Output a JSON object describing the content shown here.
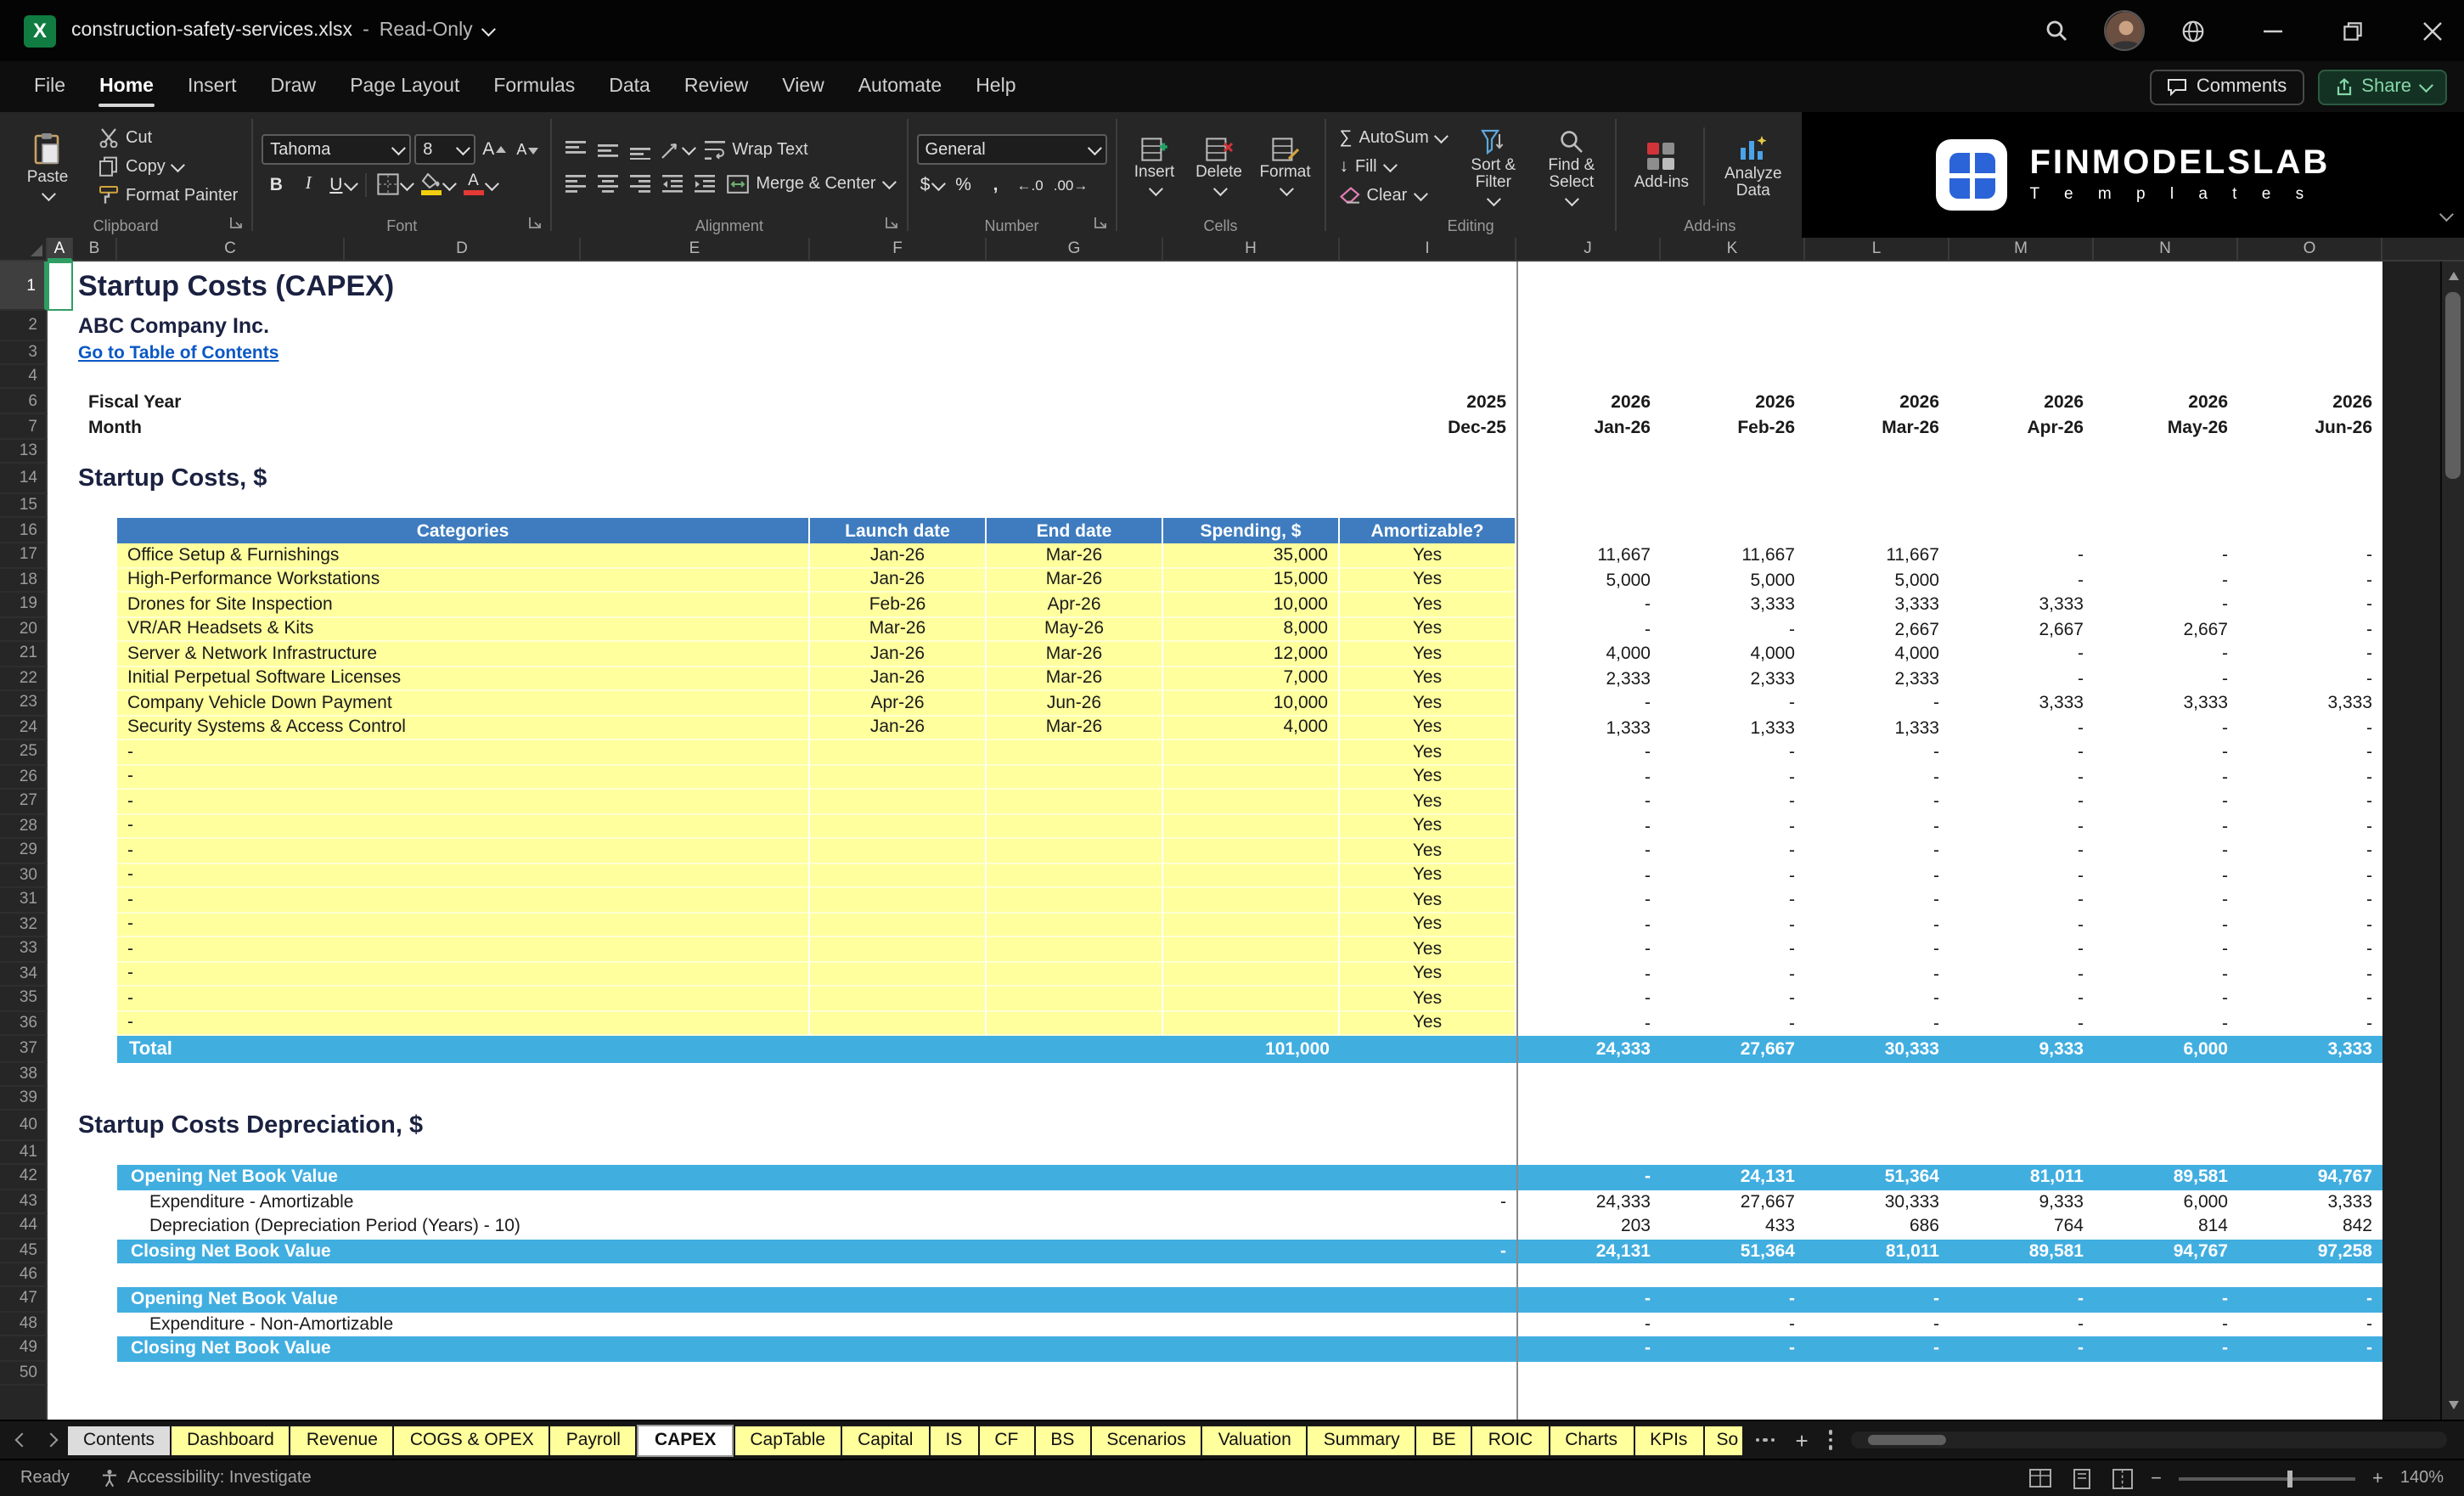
{
  "window": {
    "filename": "construction-safety-services.xlsx",
    "separator": "-",
    "mode": "Read-Only"
  },
  "menu": {
    "items": [
      "File",
      "Home",
      "Insert",
      "Draw",
      "Page Layout",
      "Formulas",
      "Data",
      "Review",
      "View",
      "Automate",
      "Help"
    ],
    "active_index": 1,
    "comments": "Comments",
    "share": "Share"
  },
  "ribbon": {
    "clipboard": {
      "group": "Clipboard",
      "paste": "Paste",
      "cut": "Cut",
      "copy": "Copy",
      "format_painter": "Format Painter"
    },
    "font": {
      "group": "Font",
      "family": "Tahoma",
      "size": "8"
    },
    "alignment": {
      "group": "Alignment",
      "wrap_text": "Wrap Text",
      "merge_center": "Merge & Center"
    },
    "number": {
      "group": "Number",
      "format": "General",
      "currency": "$",
      "percent": "%",
      "comma": ",",
      "increase_decimal": "←.0",
      "decrease_decimal": ".00→"
    },
    "cells": {
      "group": "Cells",
      "insert": "Insert",
      "delete": "Delete",
      "format": "Format"
    },
    "editing": {
      "group": "Editing",
      "autosum": "AutoSum",
      "fill": "Fill",
      "clear": "Clear",
      "sort_filter": "Sort & Filter",
      "find_select": "Find & Select"
    },
    "addins": {
      "group": "Add-ins",
      "addins": "Add-ins",
      "analyze": "Analyze Data"
    },
    "brand": {
      "name": "FINMODELSLAB",
      "tagline": "T e m p l a t e s"
    }
  },
  "colors": {
    "excel_green": "#107C41",
    "table_header_blue": "#3E7CBF",
    "band_cyan": "#41AEE0",
    "input_yellow": "#FFFF9E",
    "hyperlink_blue": "#0A58C4",
    "heading_navy": "#1B2140"
  },
  "sheet": {
    "columns": [
      "A",
      "B",
      "C",
      "D",
      "E",
      "F",
      "G",
      "H",
      "I",
      "J",
      "K",
      "L",
      "M",
      "N",
      "O"
    ],
    "rows": [
      {
        "n": "1",
        "type": "title",
        "text": "Startup Costs (CAPEX)"
      },
      {
        "n": "2",
        "type": "company",
        "text": "ABC Company Inc."
      },
      {
        "n": "3",
        "type": "link",
        "text": "Go to Table of Contents"
      },
      {
        "n": "4",
        "type": "blank"
      },
      {
        "n": "6",
        "type": "period",
        "label": "Fiscal Year",
        "dec": "2025",
        "months": [
          "2026",
          "2026",
          "2026",
          "2026",
          "2026",
          "2026"
        ]
      },
      {
        "n": "7",
        "type": "period",
        "label": "Month",
        "dec": "Dec-25",
        "months": [
          "Jan-26",
          "Feb-26",
          "Mar-26",
          "Apr-26",
          "May-26",
          "Jun-26"
        ]
      },
      {
        "n": "13",
        "type": "blank"
      },
      {
        "n": "14",
        "type": "heading",
        "text": "Startup Costs, $"
      },
      {
        "n": "15",
        "type": "blank"
      },
      {
        "n": "16",
        "type": "thead",
        "headers": [
          "Categories",
          "Launch date",
          "End date",
          "Spending, $",
          "Amortizable?"
        ]
      },
      {
        "n": "17",
        "type": "cost",
        "category": "Office Setup & Furnishings",
        "launch": "Jan-26",
        "end": "Mar-26",
        "spending": "35,000",
        "amort": "Yes",
        "monthly": [
          "11,667",
          "11,667",
          "11,667",
          "-",
          "-",
          "-"
        ]
      },
      {
        "n": "18",
        "type": "cost",
        "category": "High-Performance Workstations",
        "launch": "Jan-26",
        "end": "Mar-26",
        "spending": "15,000",
        "amort": "Yes",
        "monthly": [
          "5,000",
          "5,000",
          "5,000",
          "-",
          "-",
          "-"
        ]
      },
      {
        "n": "19",
        "type": "cost",
        "category": "Drones for Site Inspection",
        "launch": "Feb-26",
        "end": "Apr-26",
        "spending": "10,000",
        "amort": "Yes",
        "monthly": [
          "-",
          "3,333",
          "3,333",
          "3,333",
          "-",
          "-"
        ]
      },
      {
        "n": "20",
        "type": "cost",
        "category": "VR/AR Headsets & Kits",
        "launch": "Mar-26",
        "end": "May-26",
        "spending": "8,000",
        "amort": "Yes",
        "monthly": [
          "-",
          "-",
          "2,667",
          "2,667",
          "2,667",
          "-"
        ]
      },
      {
        "n": "21",
        "type": "cost",
        "category": "Server & Network Infrastructure",
        "launch": "Jan-26",
        "end": "Mar-26",
        "spending": "12,000",
        "amort": "Yes",
        "monthly": [
          "4,000",
          "4,000",
          "4,000",
          "-",
          "-",
          "-"
        ]
      },
      {
        "n": "22",
        "type": "cost",
        "category": "Initial Perpetual Software Licenses",
        "launch": "Jan-26",
        "end": "Mar-26",
        "spending": "7,000",
        "amort": "Yes",
        "monthly": [
          "2,333",
          "2,333",
          "2,333",
          "-",
          "-",
          "-"
        ]
      },
      {
        "n": "23",
        "type": "cost",
        "category": "Company Vehicle Down Payment",
        "launch": "Apr-26",
        "end": "Jun-26",
        "spending": "10,000",
        "amort": "Yes",
        "monthly": [
          "-",
          "-",
          "-",
          "3,333",
          "3,333",
          "3,333"
        ]
      },
      {
        "n": "24",
        "type": "cost",
        "category": "Security Systems & Access Control",
        "launch": "Jan-26",
        "end": "Mar-26",
        "spending": "4,000",
        "amort": "Yes",
        "monthly": [
          "1,333",
          "1,333",
          "1,333",
          "-",
          "-",
          "-"
        ]
      },
      {
        "n": "25",
        "type": "cost",
        "category": "-",
        "launch": "",
        "end": "",
        "spending": "",
        "amort": "Yes",
        "monthly": [
          "-",
          "-",
          "-",
          "-",
          "-",
          "-"
        ]
      },
      {
        "n": "26",
        "type": "cost",
        "category": "-",
        "launch": "",
        "end": "",
        "spending": "",
        "amort": "Yes",
        "monthly": [
          "-",
          "-",
          "-",
          "-",
          "-",
          "-"
        ]
      },
      {
        "n": "27",
        "type": "cost",
        "category": "-",
        "launch": "",
        "end": "",
        "spending": "",
        "amort": "Yes",
        "monthly": [
          "-",
          "-",
          "-",
          "-",
          "-",
          "-"
        ]
      },
      {
        "n": "28",
        "type": "cost",
        "category": "-",
        "launch": "",
        "end": "",
        "spending": "",
        "amort": "Yes",
        "monthly": [
          "-",
          "-",
          "-",
          "-",
          "-",
          "-"
        ]
      },
      {
        "n": "29",
        "type": "cost",
        "category": "-",
        "launch": "",
        "end": "",
        "spending": "",
        "amort": "Yes",
        "monthly": [
          "-",
          "-",
          "-",
          "-",
          "-",
          "-"
        ]
      },
      {
        "n": "30",
        "type": "cost",
        "category": "-",
        "launch": "",
        "end": "",
        "spending": "",
        "amort": "Yes",
        "monthly": [
          "-",
          "-",
          "-",
          "-",
          "-",
          "-"
        ]
      },
      {
        "n": "31",
        "type": "cost",
        "category": "-",
        "launch": "",
        "end": "",
        "spending": "",
        "amort": "Yes",
        "monthly": [
          "-",
          "-",
          "-",
          "-",
          "-",
          "-"
        ]
      },
      {
        "n": "32",
        "type": "cost",
        "category": "-",
        "launch": "",
        "end": "",
        "spending": "",
        "amort": "Yes",
        "monthly": [
          "-",
          "-",
          "-",
          "-",
          "-",
          "-"
        ]
      },
      {
        "n": "33",
        "type": "cost",
        "category": "-",
        "launch": "",
        "end": "",
        "spending": "",
        "amort": "Yes",
        "monthly": [
          "-",
          "-",
          "-",
          "-",
          "-",
          "-"
        ]
      },
      {
        "n": "34",
        "type": "cost",
        "category": "-",
        "launch": "",
        "end": "",
        "spending": "",
        "amort": "Yes",
        "monthly": [
          "-",
          "-",
          "-",
          "-",
          "-",
          "-"
        ]
      },
      {
        "n": "35",
        "type": "cost",
        "category": "-",
        "launch": "",
        "end": "",
        "spending": "",
        "amort": "Yes",
        "monthly": [
          "-",
          "-",
          "-",
          "-",
          "-",
          "-"
        ]
      },
      {
        "n": "36",
        "type": "cost",
        "category": "-",
        "launch": "",
        "end": "",
        "spending": "",
        "amort": "Yes",
        "monthly": [
          "-",
          "-",
          "-",
          "-",
          "-",
          "-"
        ]
      },
      {
        "n": "37",
        "type": "total",
        "label": "Total",
        "spending": "101,000",
        "monthly": [
          "24,333",
          "27,667",
          "30,333",
          "9,333",
          "6,000",
          "3,333"
        ]
      },
      {
        "n": "38",
        "type": "blank"
      },
      {
        "n": "39",
        "type": "blank"
      },
      {
        "n": "40",
        "type": "heading",
        "text": "Startup Costs Depreciation, $"
      },
      {
        "n": "41",
        "type": "blank"
      },
      {
        "n": "42",
        "type": "band",
        "label": "Opening Net Book Value",
        "dec": "",
        "values": [
          "-",
          "24,131",
          "51,364",
          "81,011",
          "89,581",
          "94,767"
        ]
      },
      {
        "n": "43",
        "type": "dep",
        "label": "Expenditure - Amortizable",
        "dec": "-",
        "values": [
          "24,333",
          "27,667",
          "30,333",
          "9,333",
          "6,000",
          "3,333"
        ]
      },
      {
        "n": "44",
        "type": "dep",
        "label": "Depreciation (Depreciation Period (Years) - 10)",
        "dec": "",
        "values": [
          "203",
          "433",
          "686",
          "764",
          "814",
          "842"
        ]
      },
      {
        "n": "45",
        "type": "band",
        "label": "Closing Net Book Value",
        "dec": "-",
        "values": [
          "24,131",
          "51,364",
          "81,011",
          "89,581",
          "94,767",
          "97,258"
        ]
      },
      {
        "n": "46",
        "type": "blank"
      },
      {
        "n": "47",
        "type": "band",
        "label": "Opening Net Book Value",
        "dec": "",
        "values": [
          "-",
          "-",
          "-",
          "-",
          "-",
          "-"
        ]
      },
      {
        "n": "48",
        "type": "dep",
        "label": "Expenditure - Non-Amortizable",
        "dec": "",
        "values": [
          "-",
          "-",
          "-",
          "-",
          "-",
          "-"
        ]
      },
      {
        "n": "49",
        "type": "band",
        "label": "Closing Net Book Value",
        "dec": "",
        "values": [
          "-",
          "-",
          "-",
          "-",
          "-",
          "-"
        ]
      },
      {
        "n": "50",
        "type": "blank"
      }
    ]
  },
  "tabs": {
    "items": [
      {
        "label": "Contents",
        "style": "gray"
      },
      {
        "label": "Dashboard",
        "style": "yellow"
      },
      {
        "label": "Revenue",
        "style": "yellow"
      },
      {
        "label": "COGS & OPEX",
        "style": "yellow"
      },
      {
        "label": "Payroll",
        "style": "yellow"
      },
      {
        "label": "CAPEX",
        "style": "active"
      },
      {
        "label": "CapTable",
        "style": "yellow"
      },
      {
        "label": "Capital",
        "style": "yellow"
      },
      {
        "label": "IS",
        "style": "yellow"
      },
      {
        "label": "CF",
        "style": "yellow"
      },
      {
        "label": "BS",
        "style": "yellow"
      },
      {
        "label": "Scenarios",
        "style": "yellow"
      },
      {
        "label": "Valuation",
        "style": "yellow"
      },
      {
        "label": "Summary",
        "style": "yellow"
      },
      {
        "label": "BE",
        "style": "yellow"
      },
      {
        "label": "ROIC",
        "style": "yellow"
      },
      {
        "label": "Charts",
        "style": "yellow"
      },
      {
        "label": "KPIs",
        "style": "yellow"
      },
      {
        "label": "So",
        "style": "yellow",
        "clipped": true
      }
    ]
  },
  "status": {
    "ready": "Ready",
    "accessibility": "Accessibility: Investigate",
    "zoom": "140%"
  }
}
